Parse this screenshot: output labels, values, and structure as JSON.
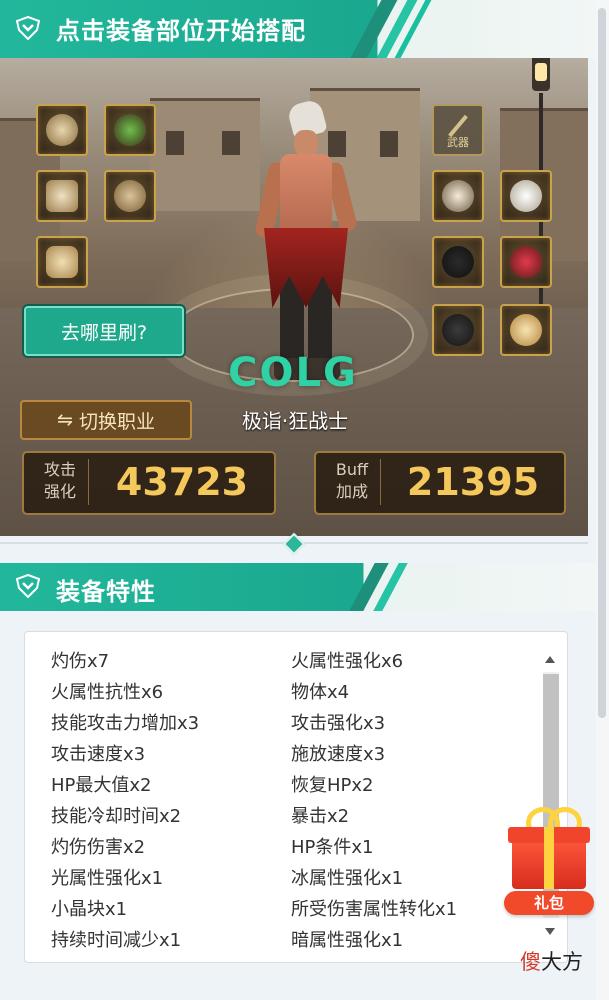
{
  "header": {
    "title": "点击装备部位开始搭配"
  },
  "equipment": {
    "weapon_label": "武器",
    "left_slots": [
      "shoulder-armor-icon",
      "top-armor-icon",
      "pants-icon",
      "belt-icon",
      "boots-icon"
    ],
    "right_slots": [
      "bracelet-icon",
      "necklace-icon",
      "ring-icon",
      "sub-equip-icon",
      "magic-stone-icon",
      "earring-icon"
    ]
  },
  "actions": {
    "where_farm_label": "去哪里刷?",
    "switch_job_icon": "⇋",
    "switch_job_label": "切换职业"
  },
  "character": {
    "logo_text": "COLG",
    "job_name": "极诣·狂战士"
  },
  "stats": {
    "attack": {
      "caption_line1": "攻击",
      "caption_line2": "强化",
      "value": "43723"
    },
    "buff": {
      "caption_line1": "Buff",
      "caption_line2": "加成",
      "value": "21395"
    }
  },
  "traits_section": {
    "title": "装备特性",
    "left": [
      "灼伤x7",
      "火属性抗性x6",
      "技能攻击力增加x3",
      "攻击速度x3",
      "HP最大值x2",
      "技能冷却时间x2",
      "灼伤伤害x2",
      "光属性强化x1",
      "小晶块x1",
      "持续时间减少x1"
    ],
    "right": [
      "火属性强化x6",
      "物体x4",
      "攻击强化x3",
      "施放速度x3",
      "恢复HPx2",
      "暴击x2",
      "HP条件x1",
      "冰属性强化x1",
      "所受伤害属性转化x1",
      "暗属性强化x1"
    ]
  },
  "gift": {
    "label": "礼包"
  },
  "watermark": {
    "char1": "傻",
    "rest": "大方"
  },
  "colors": {
    "accent": "#22b79c",
    "gold": "#f4c85a",
    "gift": "#f04a2a"
  }
}
